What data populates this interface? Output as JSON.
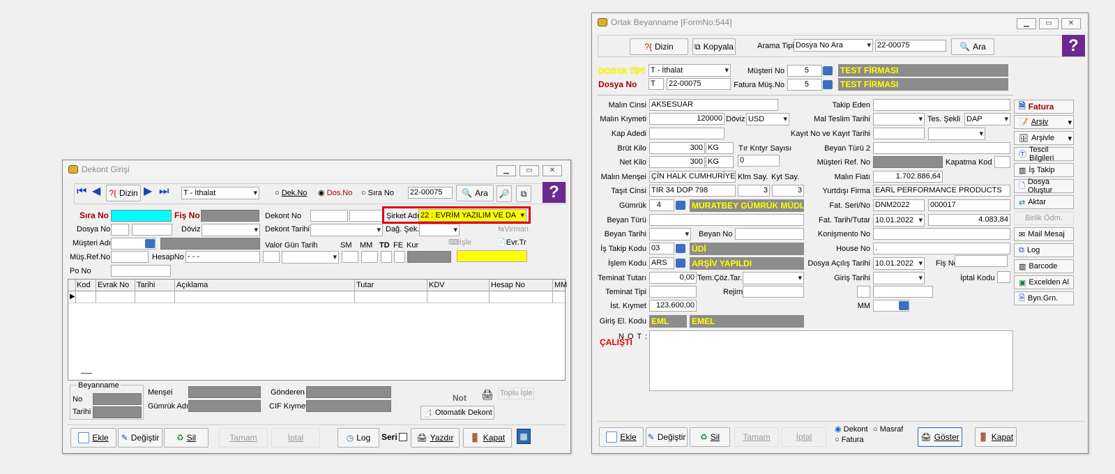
{
  "dek": {
    "title": "Dekont Girişi",
    "toolbar": {
      "dizin": "Dizin",
      "type": "T - İthalat",
      "r_dek": "Dek.No",
      "r_dos": "Dos.No",
      "r_sira": "Sıra No",
      "search": "22-00075",
      "ara": "Ara"
    },
    "labels": {
      "sira_no": "Sıra No",
      "fis_no": "Fiş No",
      "dekont_no": "Dekont No",
      "sirket_adi": "Şirket Adı",
      "dosya_no": "Dosya No",
      "doviz": "Döviz",
      "dekont_tarihi": "Dekont Tarihi",
      "dag_sek": "Dağ. Şek.",
      "musteri_adi": "Müşteri Adı",
      "valor": "Valor Gün Tarih",
      "sm": "SM",
      "mm": "MM",
      "td": "TD",
      "fe": "FE",
      "kur": "Kur",
      "mus_ref": "Müş.Ref.No",
      "hesapno": "HesapNo",
      "po_no": "Po No",
      "virman": "Virman",
      "isle": "İşle",
      "evr": "Evr.Tr"
    },
    "values": {
      "sirket": "22 : EVRİM YAZILIM  VE DA",
      "hesap_mask": " -  -  -"
    },
    "columns": [
      "Kod",
      "Evrak No",
      "Tarihi",
      "Açıklama",
      "Tutar",
      "KDV",
      "Hesap No",
      "MM"
    ],
    "bottom": {
      "beyanname": "Beyanname",
      "no": "No",
      "tarihi": "Tarihi",
      "mensei": "Menşei",
      "gumruk_adi": "Gümrük Adı",
      "gonderen": "Gönderen",
      "cif": "CIF Kıymet",
      "not": "Not",
      "toplu": "Toplu İşle",
      "otomatik": "Otomatik Dekont"
    },
    "buttons": {
      "ekle": "Ekle",
      "degistir": "Değiştir",
      "sil": "Sil",
      "tamam": "Tamam",
      "iptal": "İptal",
      "log": "Log",
      "seri": "Seri",
      "yazdir": "Yazdır",
      "kapat": "Kapat"
    }
  },
  "ortak": {
    "title": "Ortak Beyanname [FormNo:544]",
    "toolbar": {
      "dizin": "Dizin",
      "kopyala": "Kopyala",
      "arama_tipi": "Arama Tipi",
      "arama_val": "Dosya No Ara",
      "search": "22-00075",
      "ara": "Ara"
    },
    "head": {
      "dosya_tipi": "DOSYA TİPİ",
      "dosya_tipi_val": "T - İthalat",
      "dosya_no": "Dosya No",
      "prefix": "T",
      "dosya_no_val": "22-00075",
      "musteri_no": "Müşteri No",
      "musteri_no_val": "5",
      "fatura_mus": "Fatura Müş.No",
      "fatura_mus_val": "5",
      "firma1": "TEST FİRMASI",
      "firma2": "TEST FİRMASI"
    },
    "left": {
      "malin_cinsi": "Malın Cinsi",
      "malin_cinsi_val": "AKSESUAR",
      "malin_kiymeti": "Malın Kıymeti",
      "malin_kiymeti_val": "120000",
      "doviz": "Döviz",
      "doviz_val": "USD",
      "kap_adedi": "Kap Adedi",
      "brut_kilo": "Brüt Kilo",
      "brut_val": "300",
      "brut_unit": "KG",
      "tir": "Tır Kntyr Sayısı",
      "net_kilo": "Net Kilo",
      "net_val": "300",
      "net_unit": "KG",
      "tir_val": "0",
      "mensei": "Malın Menşei",
      "mensei_val": "ÇİN HALK CUMHURİYET",
      "klm": "Klm Say.",
      "kyt": "Kyt Say.",
      "tasit": "Taşıt Cinsi",
      "tasit_val": "TIR 34 DOP 798",
      "klm_val": "3",
      "kyt_val": "3",
      "gumruk": "Gümrük",
      "gumruk_val": "4",
      "gumruk_name": "MURATBEY GÜMRÜK MÜDL",
      "beyan_turu": "Beyan Türü",
      "beyan_tarihi": "Beyan Tarihi",
      "beyan_no": "Beyan No",
      "is_takip": "İş Takip Kodu",
      "is_takip_val": "03",
      "is_takip_name": "ÜDİ",
      "islem": "İşlem Kodu",
      "islem_val": "ARS",
      "islem_name": "ARŞİV YAPILDI",
      "teminat_tutari": "Teminat Tutarı",
      "teminat_val": "0,00",
      "tem_coz": "Tem.Çöz.Tar.",
      "teminat_tipi": "Teminat Tipi",
      "rejim": "Rejim",
      "ist_kiymet": "İst. Kıymet",
      "ist_val": "123.600,00",
      "giris_el": "Giriş El. Kodu",
      "giris_el_val": "EML",
      "giris_el_name": "EMEL",
      "not": "N O T :",
      "calisti": "ÇALIŞTI"
    },
    "right": {
      "takip_eden": "Takip Eden",
      "mal_teslim": "Mal Teslim Tarihi",
      "tes_sekli": "Tes. Şekli",
      "tes_val": "DAP",
      "kayit": "Kayıt  No  ve Kayıt Tarihi",
      "beyan_turu2": "Beyan Türü 2",
      "musteri_ref": "Müşteri  Ref.  No",
      "kapatma": "Kapatma Kod",
      "malin_fiati": "Malın Fiatı",
      "malin_fiati_val": "1.702.886,64",
      "yurtdisi": "Yurtdışı Firma",
      "yurtdisi_val": "EARL PERFORMANCE PRODUCTS",
      "fat_seri": "Fat. Seri/No",
      "fat_seri_val": "DNM2022",
      "fat_no_val": "000017",
      "fat_tarih": "Fat. Tarih/Tutar",
      "fat_tarih_val": "10.01.2022",
      "fat_tutar_val": "4.083,84",
      "konismento": "Konişmento No",
      "house": "House No",
      "house_val": ".",
      "dosya_acilis": "Dosya Açılış Tarihi",
      "dosya_acilis_val": "10.01.2022",
      "fis_no": "Fiş No",
      "giris_tarihi": "Giriş Tarihi",
      "iptal_kodu": "İptal Kodu",
      "mm": "MM"
    },
    "side": [
      "Fatura",
      "Arşiv",
      "Arşivle",
      "Tescil Bilgileri",
      "İş Takip",
      "Dosya Oluştur",
      "Aktar",
      "Birlik Ödm.",
      "Mail Mesaj",
      "Log",
      "Barcode",
      "Excelden Al",
      "Byn.Grn."
    ],
    "buttons": {
      "ekle": "Ekle",
      "degistir": "Değiştir",
      "sil": "Sil",
      "tamam": "Tamam",
      "iptal": "İptal",
      "dekont": "Dekont",
      "masraf": "Masraf",
      "fatura": "Fatura",
      "goster": "Göster",
      "kapat": "Kapat"
    }
  }
}
